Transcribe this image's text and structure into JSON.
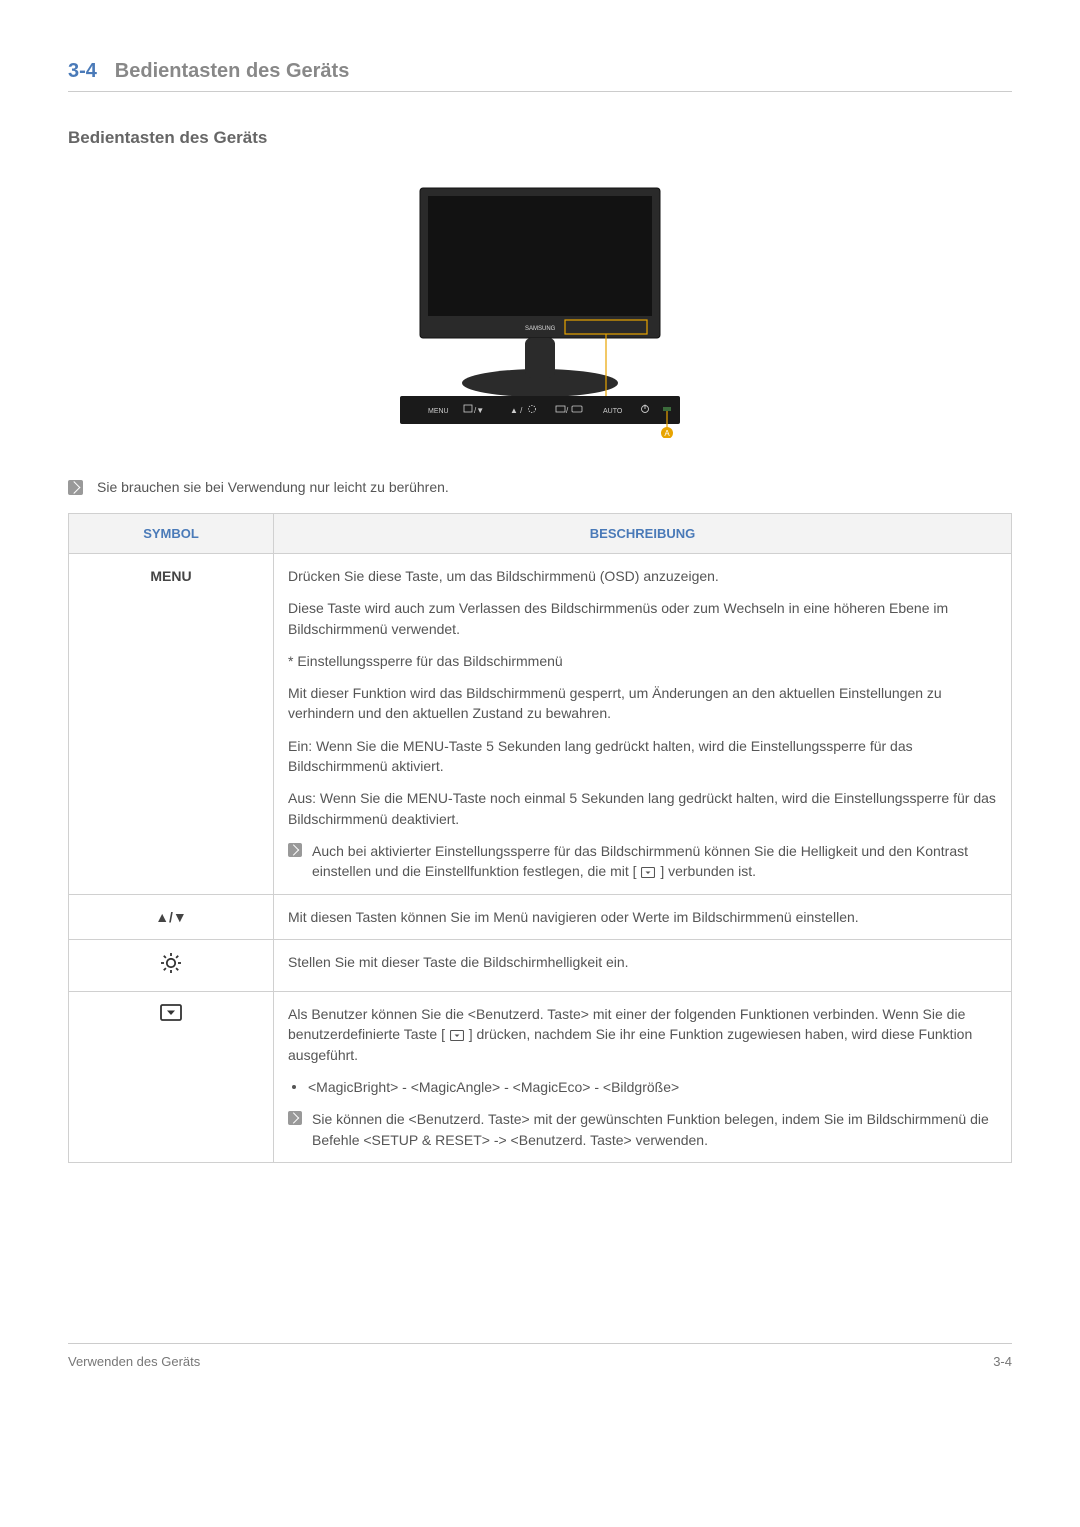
{
  "header": {
    "number": "3-4",
    "title": "Bedientasten des Geräts"
  },
  "subheading": "Bedientasten des Geräts",
  "monitor": {
    "brand": "SAMSUNG",
    "buttons": [
      "MENU",
      "",
      "",
      "",
      "AUTO",
      ""
    ]
  },
  "top_note": "Sie brauchen sie bei Verwendung nur leicht zu berühren.",
  "table": {
    "head_symbol": "SYMBOL",
    "head_desc": "BESCHREIBUNG",
    "rows": {
      "menu": {
        "symbol": "MENU",
        "p1": "Drücken Sie diese Taste, um das Bildschirmmenü (OSD) anzuzeigen.",
        "p2": "Diese Taste wird auch zum Verlassen des Bildschirmmenüs oder zum Wechseln in eine höheren Ebene im Bildschirmmenü verwendet.",
        "p3": "* Einstellungssperre für das Bildschirmmenü",
        "p4": "Mit dieser Funktion wird das Bildschirmmenü gesperrt, um Änderungen an den aktuellen Einstellungen zu verhindern und den aktuellen Zustand zu bewahren.",
        "p5": "Ein: Wenn Sie die MENU-Taste 5 Sekunden lang gedrückt halten, wird die Einstellungssperre für das Bildschirmmenü aktiviert.",
        "p6": "Aus: Wenn Sie die MENU-Taste noch einmal 5 Sekunden lang gedrückt halten, wird die Einstellungssperre für das Bildschirmmenü deaktiviert.",
        "note_a": "Auch bei aktivierter Einstellungssperre für das Bildschirmmenü können Sie die Helligkeit und den Kontrast einstellen und die Einstellfunktion festlegen, die mit [",
        "note_b": "] verbunden ist."
      },
      "arrows": {
        "symbol": "▲/▼",
        "p1": "Mit diesen Tasten können Sie im Menü navigieren oder Werte im Bildschirmmenü einstellen."
      },
      "bright": {
        "p1": "Stellen Sie mit dieser Taste die Bildschirmhelligkeit ein."
      },
      "custom": {
        "p1a": "Als Benutzer können Sie die <Benutzerd. Taste> mit einer der folgenden Funktionen verbinden. Wenn Sie die benutzerdefinierte Taste [",
        "p1b": "] drücken, nachdem Sie ihr eine Funktion zugewiesen haben, wird diese Funktion ausgeführt.",
        "bullet": "<MagicBright> - <MagicAngle> - <MagicEco> - <Bildgröße>",
        "note": "Sie können die <Benutzerd. Taste> mit der gewünschten Funktion belegen, indem Sie im Bildschirmmenü die Befehle <SETUP & RESET> -> <Benutzerd. Taste> verwenden."
      }
    }
  },
  "footer": {
    "left": "Verwenden des Geräts",
    "right": "3-4"
  }
}
